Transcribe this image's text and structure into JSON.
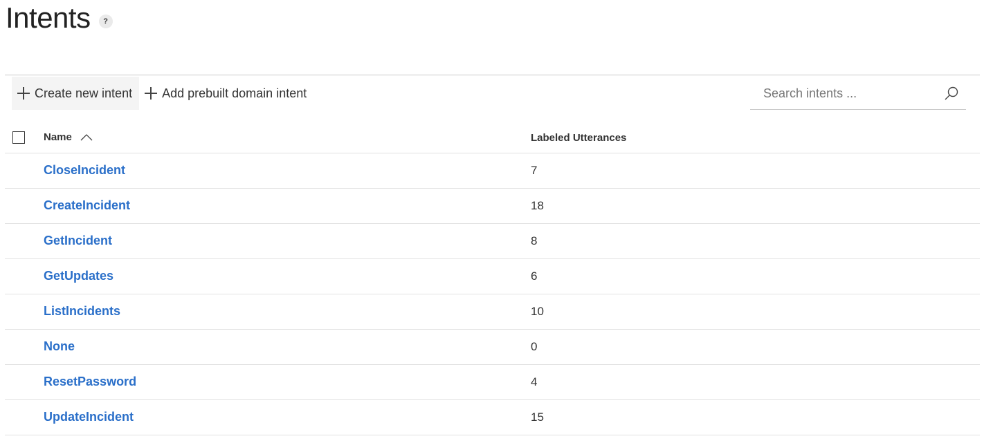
{
  "page": {
    "title": "Intents",
    "help_label": "?"
  },
  "toolbar": {
    "create_label": "Create new intent",
    "prebuilt_label": "Add prebuilt domain intent"
  },
  "search": {
    "placeholder": "Search intents ...",
    "icon": "search-icon"
  },
  "table": {
    "columns": {
      "name": "Name",
      "utterances": "Labeled Utterances"
    },
    "sort": {
      "column": "name",
      "direction": "ascending"
    },
    "rows": [
      {
        "name": "CloseIncident",
        "count": "7"
      },
      {
        "name": "CreateIncident",
        "count": "18"
      },
      {
        "name": "GetIncident",
        "count": "8"
      },
      {
        "name": "GetUpdates",
        "count": "6"
      },
      {
        "name": "ListIncidents",
        "count": "10"
      },
      {
        "name": "None",
        "count": "0"
      },
      {
        "name": "ResetPassword",
        "count": "4"
      },
      {
        "name": "UpdateIncident",
        "count": "15"
      }
    ]
  },
  "colors": {
    "link": "#2a6fc9",
    "text": "#333333",
    "divider": "#e1e1e1"
  }
}
